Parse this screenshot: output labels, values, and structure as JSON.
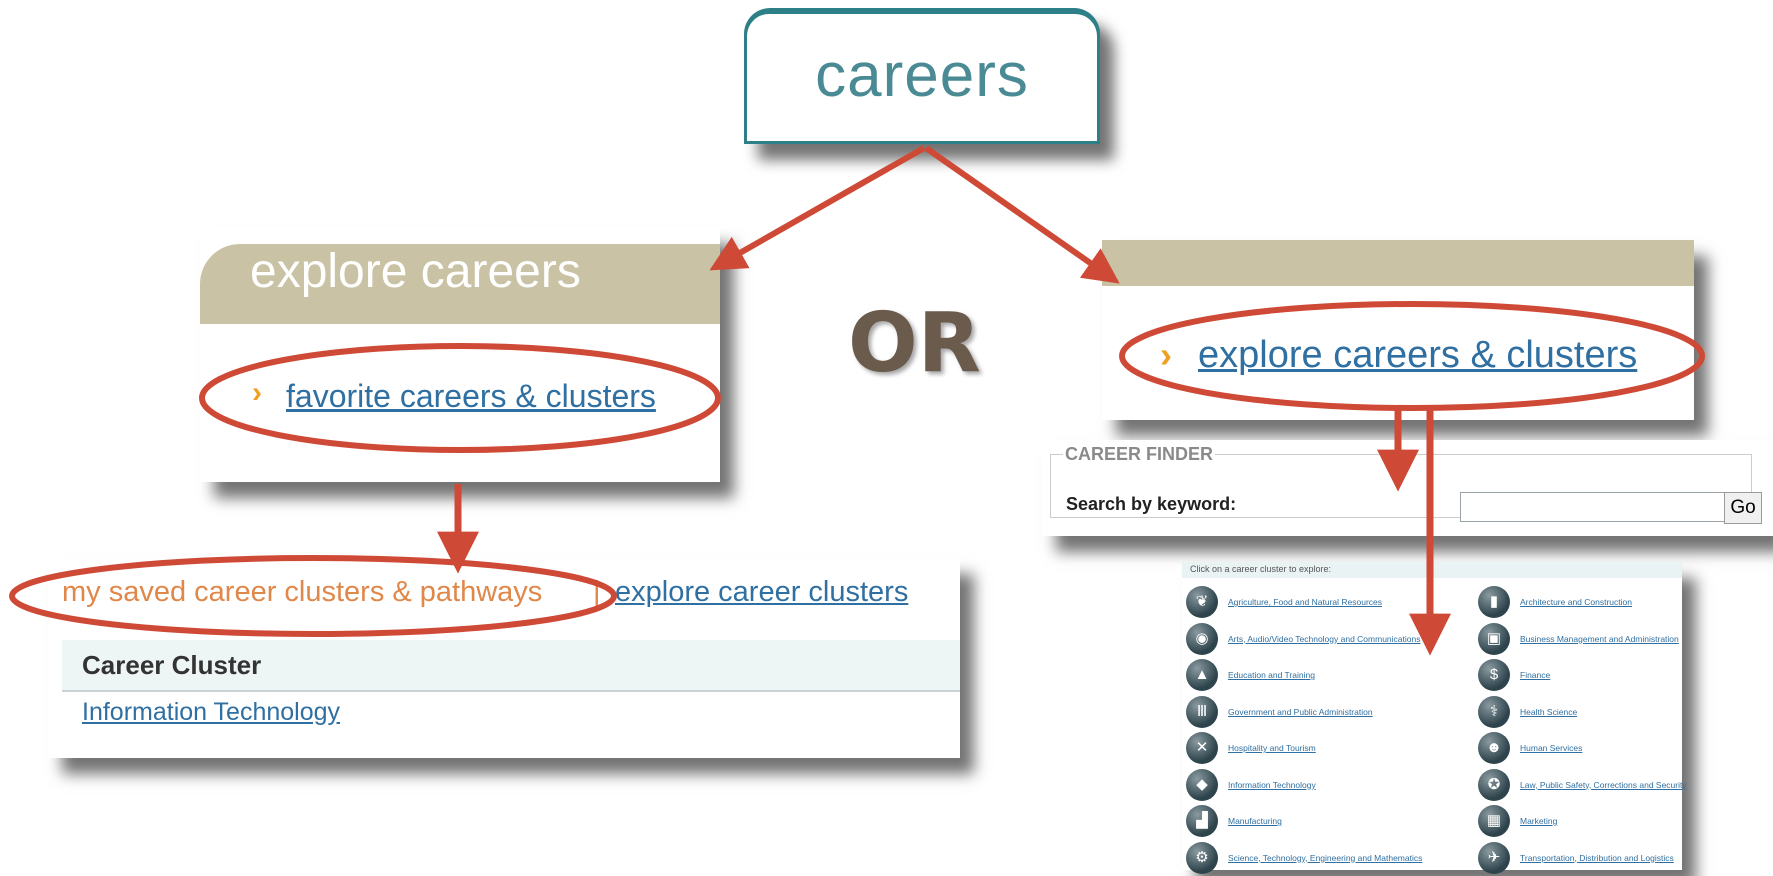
{
  "careers_tab": {
    "label": "careers"
  },
  "explore_panel": {
    "title": "explore careers",
    "link": "favorite careers & clusters",
    "chevron": "›"
  },
  "or_label": "OR",
  "right_panel": {
    "link": "explore careers & clusters",
    "chevron": "›"
  },
  "saved_panel": {
    "tab_saved": "my saved career clusters & pathways",
    "separator": "|",
    "tab_explore": "explore career clusters",
    "column_header": "Career Cluster",
    "rows": [
      "Information Technology"
    ]
  },
  "career_finder": {
    "legend": "CAREER FINDER",
    "keyword_label": "Search by keyword:",
    "search_value": "",
    "go_button": "Go"
  },
  "cluster_grid": {
    "heading": "Click on a career cluster to explore:",
    "left_items": [
      "Agriculture, Food and Natural Resources",
      "Arts, Audio/Video Technology and Communications",
      "Education and Training",
      "Government and Public Administration",
      "Hospitality and Tourism",
      "Information Technology",
      "Manufacturing",
      "Science, Technology, Engineering and Mathematics"
    ],
    "right_items": [
      "Architecture and Construction",
      "Business Management and Administration",
      "Finance",
      "Health Science",
      "Human Services",
      "Law, Public Safety, Corrections and Security",
      "Marketing",
      "Transportation, Distribution and Logistics"
    ],
    "left_icons": [
      "leaf-icon",
      "camera-icon",
      "graduation-cap-icon",
      "capitol-icon",
      "utensils-icon",
      "computer-icon",
      "factory-icon",
      "gears-icon"
    ],
    "right_icons": [
      "buildings-icon",
      "briefcase-icon",
      "money-icon",
      "caduceus-icon",
      "people-icon",
      "badge-icon",
      "chart-icon",
      "airplane-icon"
    ]
  },
  "colors": {
    "arrow": "#cf4a36",
    "tab_teal": "#2d7f88",
    "panel_bar": "#c9c2a4",
    "link_blue": "#2f6fa1",
    "saved_orange": "#e0874a"
  }
}
